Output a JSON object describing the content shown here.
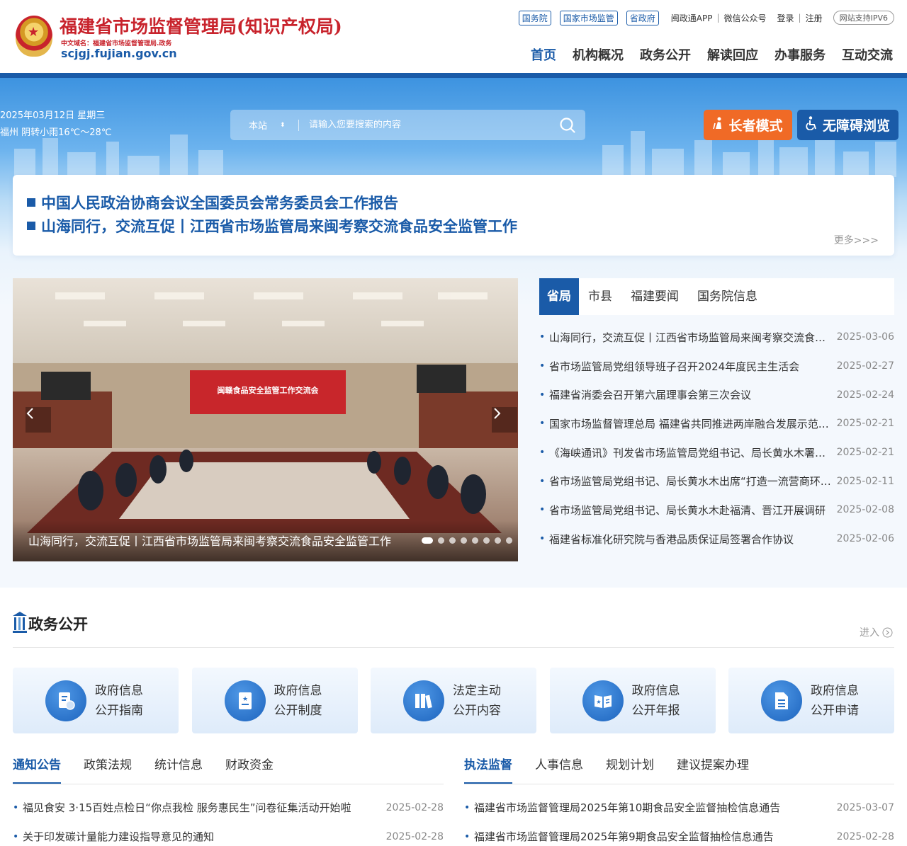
{
  "header": {
    "site_name": "福建省市场监督管理局(知识产权局)",
    "cn_domain": "中文域名：福建省市场监督管理局.政务",
    "domain_url": "scjgj.fujian.gov.cn",
    "top_links": {
      "box1": "国务院",
      "box2": "国家市场监管",
      "box3": "省政府",
      "app": "闽政通APP",
      "wechat": "微信公众号",
      "login": "登录",
      "register": "注册",
      "ipv6": "网站支持IPV6",
      "sep": "|"
    },
    "nav": [
      "首页",
      "机构概况",
      "政务公开",
      "解读回应",
      "办事服务",
      "互动交流"
    ]
  },
  "weather": {
    "date": "2025年03月12日 星期三",
    "weather": "福州 阴转小雨16℃～28℃"
  },
  "search": {
    "scope": "本站",
    "placeholder": "请输入您要搜索的内容"
  },
  "modes": {
    "elder": "长者模式",
    "accessible": "无障碍浏览"
  },
  "headlines": {
    "items": [
      "中国人民政治协商会议全国委员会常务委员会工作报告",
      "山海同行，交流互促丨江西省市场监管局来闽考察交流食品安全监管工作"
    ],
    "more": "更多>>>"
  },
  "carousel": {
    "caption": "山海同行，交流互促丨江西省市场监管局来闽考察交流食品安全监管工作",
    "screen_text": "闽赣食品安全监管工作交流会",
    "slide_count": 8,
    "active_index": 0
  },
  "news": {
    "tabs": [
      "省局",
      "市县",
      "福建要闻",
      "国务院信息"
    ],
    "items": [
      {
        "title": "山海同行，交流互促丨江西省市场监管局来闽考察交流食品安全监管工作",
        "date": "2025-03-06"
      },
      {
        "title": "省市场监管局党组领导班子召开2024年度民主生活会",
        "date": "2025-02-27"
      },
      {
        "title": "福建省消委会召开第六届理事会第三次会议",
        "date": "2025-02-24"
      },
      {
        "title": "国家市场监督管理总局 福建省共同推进两岸融合发展示范区建设",
        "date": "2025-02-21"
      },
      {
        "title": "《海峡通讯》刊发省市场监管局党组书记、局长黄水木署名文章",
        "date": "2025-02-21"
      },
      {
        "title": "省市场监管局党组书记、局长黄水木出席“打造一流营商环境”活动",
        "date": "2025-02-11"
      },
      {
        "title": "省市场监管局党组书记、局长黄水木赴福清、晋江开展调研",
        "date": "2025-02-08"
      },
      {
        "title": "福建省标准化研究院与香港品质保证局签署合作协议",
        "date": "2025-02-06"
      }
    ]
  },
  "gov_affairs": {
    "title": "政务公开",
    "enter": "进入",
    "cards": [
      {
        "line1": "政府信息",
        "line2": "公开指南"
      },
      {
        "line1": "政府信息",
        "line2": "公开制度"
      },
      {
        "line1": "法定主动",
        "line2": "公开内容"
      },
      {
        "line1": "政府信息",
        "line2": "公开年报"
      },
      {
        "line1": "政府信息",
        "line2": "公开申请"
      }
    ]
  },
  "notices": {
    "tabs": [
      "通知公告",
      "政策法规",
      "统计信息",
      "财政资金"
    ],
    "items": [
      {
        "title": "福见食安 3·15百姓点检日“你点我检 服务惠民生”问卷征集活动开始啦",
        "date": "2025-02-28"
      },
      {
        "title": "关于印发碳计量能力建设指导意见的通知",
        "date": "2025-02-28"
      }
    ]
  },
  "enforcement": {
    "tabs": [
      "执法监督",
      "人事信息",
      "规划计划",
      "建议提案办理"
    ],
    "items": [
      {
        "title": "福建省市场监督管理局2025年第10期食品安全监督抽检信息通告",
        "date": "2025-03-07"
      },
      {
        "title": "福建省市场监督管理局2025年第9期食品安全监督抽检信息通告",
        "date": "2025-02-28"
      }
    ]
  },
  "colors": {
    "brand_blue": "#1a5ba8",
    "brand_red": "#c8232c",
    "elder_orange": "#f06a26"
  }
}
